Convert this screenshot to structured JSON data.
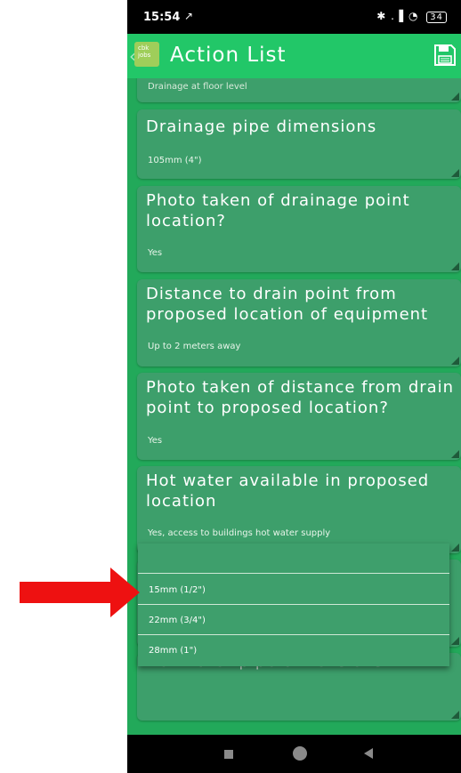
{
  "status": {
    "time": "15:54",
    "battery": "34",
    "icons_left": "↗",
    "icons_right": "✱ .▐ ◔"
  },
  "app": {
    "title": "Action List",
    "logo_text": "cbk jobs",
    "save_icon": "save-icon",
    "accent_color": "#22c768",
    "card_color": "#3d9f6b"
  },
  "cards": [
    {
      "question": "",
      "answer": "Drainage at floor level"
    },
    {
      "question": "Drainage pipe dimensions",
      "answer": "105mm (4\")"
    },
    {
      "question": "Photo taken of drainage point location?",
      "answer": "Yes"
    },
    {
      "question": "Distance to drain point from proposed location of equipment",
      "answer": "Up to 2 meters away"
    },
    {
      "question": "Photo taken of distance from drain point to proposed location?",
      "answer": "Yes"
    },
    {
      "question": "Hot water available in proposed location",
      "answer": "Yes, access to buildings hot water supply"
    },
    {
      "question": "",
      "answer": ""
    },
    {
      "question": "Hot water pipe dimensions",
      "answer": ""
    }
  ],
  "dropdown": {
    "options": [
      "",
      "15mm (1/2\")",
      "22mm (3/4\")",
      "28mm (1\")"
    ]
  },
  "annotation": {
    "arrow_color": "#ee1111"
  }
}
